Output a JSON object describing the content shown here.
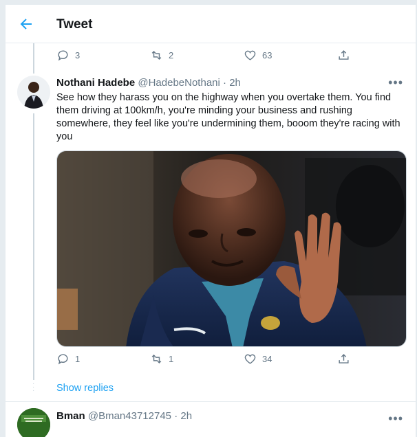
{
  "header": {
    "title": "Tweet"
  },
  "parent_actions": {
    "replies": "3",
    "retweets": "2",
    "likes": "63"
  },
  "tweet": {
    "author_name": "Nothani Hadebe",
    "handle": "@HadebeNothani",
    "dot": "·",
    "time": "2h",
    "more": "•••",
    "text": "See how they harass you on the highway when you overtake them. You find them driving at 100km/h, you're minding your business and rushing somewhere, they feel like you're undermining them, booom they're racing with you",
    "actions": {
      "replies": "1",
      "retweets": "1",
      "likes": "34"
    },
    "show_replies": "Show replies"
  },
  "next_tweet": {
    "author_name": "Bman",
    "handle": "@Bman43712745",
    "dot": "·",
    "time": "2h",
    "more": "•••"
  },
  "colors": {
    "accent": "#1da1f2",
    "secondary_text": "#657786",
    "border": "#e6ecf0"
  }
}
